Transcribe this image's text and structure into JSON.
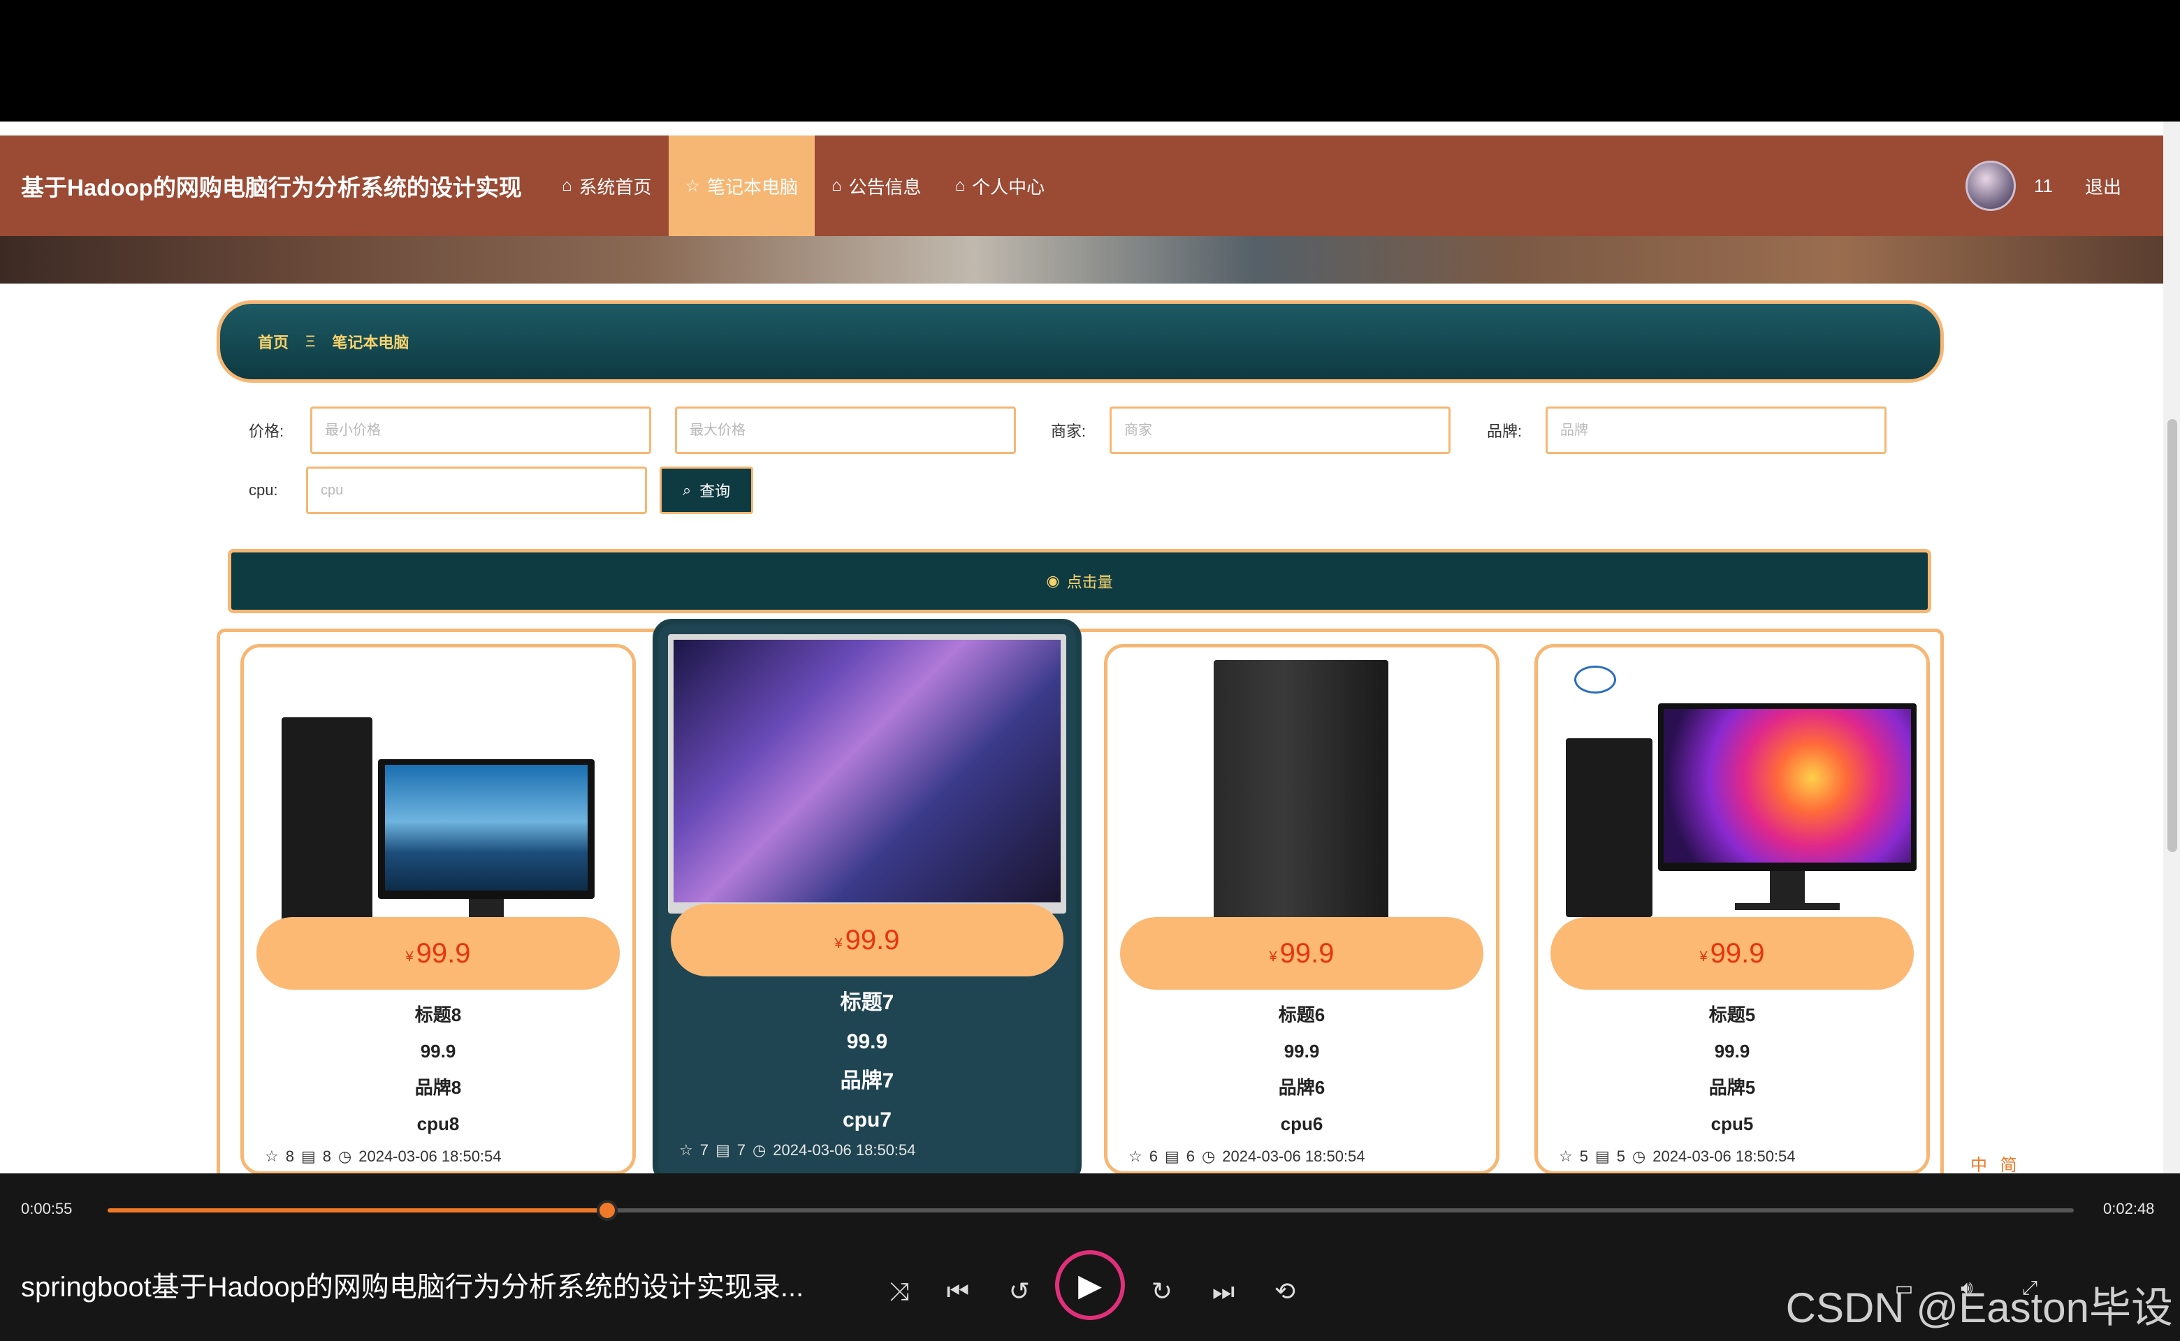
{
  "nav": {
    "title": "基于Hadoop的网购电脑行为分析系统的设计实现",
    "items": [
      {
        "label": "系统首页",
        "icon": "home-icon",
        "active": false
      },
      {
        "label": "笔记本电脑",
        "icon": "star-icon",
        "active": true
      },
      {
        "label": "公告信息",
        "icon": "bag-icon",
        "active": false
      },
      {
        "label": "个人中心",
        "icon": "home-icon",
        "active": false
      }
    ],
    "username": "11",
    "logout": "退出"
  },
  "breadcrumb": {
    "home": "首页",
    "separator": "Ξ",
    "current": "笔记本电脑"
  },
  "filters": {
    "price_label": "价格:",
    "min_price_placeholder": "最小价格",
    "max_price_placeholder": "最大价格",
    "merchant_label": "商家:",
    "merchant_placeholder": "商家",
    "brand_label": "品牌:",
    "brand_placeholder": "品牌",
    "cpu_label": "cpu:",
    "cpu_placeholder": "cpu",
    "search_button": "查询"
  },
  "sort": {
    "label": "点击量"
  },
  "products": [
    {
      "price": "99.9",
      "title": "标题8",
      "price_text": "99.9",
      "brand": "品牌8",
      "cpu": "cpu8",
      "stars": "8",
      "comments": "8",
      "date": "2024-03-06 18:50:54"
    },
    {
      "price": "99.9",
      "title": "标题7",
      "price_text": "99.9",
      "brand": "品牌7",
      "cpu": "cpu7",
      "stars": "7",
      "comments": "7",
      "date": "2024-03-06 18:50:54"
    },
    {
      "price": "99.9",
      "title": "标题6",
      "price_text": "99.9",
      "brand": "品牌6",
      "cpu": "cpu6",
      "stars": "6",
      "comments": "6",
      "date": "2024-03-06 18:50:54"
    },
    {
      "price": "99.9",
      "title": "标题5",
      "price_text": "99.9",
      "brand": "品牌5",
      "cpu": "cpu5",
      "stars": "5",
      "comments": "5",
      "date": "2024-03-06 18:50:54"
    }
  ],
  "currency_symbol": "¥",
  "player": {
    "current_time": "0:00:55",
    "total_time": "0:02:48",
    "progress": 0.254,
    "video_title": "springboot基于Hadoop的网购电脑行为分析系统的设计实现录...",
    "watermark": "CSDN @Easton毕设"
  },
  "ime": "中 简",
  "colors": {
    "nav": "#9b4a34",
    "accent": "#f6b774",
    "teal": "#0e3a42",
    "price": "#e8340c",
    "progress": "#f07a2a"
  }
}
